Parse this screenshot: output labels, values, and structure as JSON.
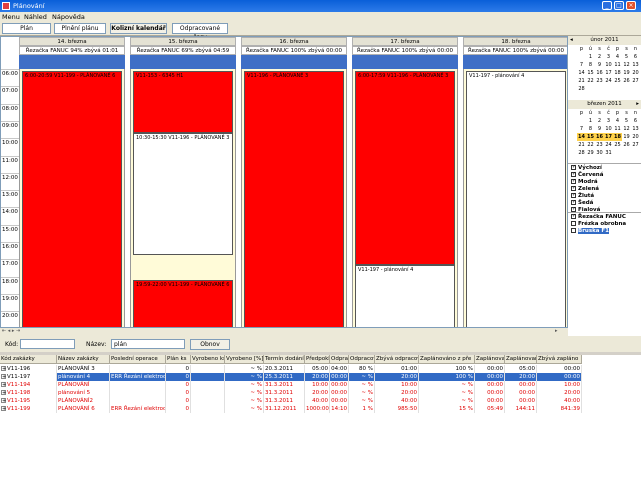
{
  "window": {
    "title": "Plánování"
  },
  "menu": [
    "Menu",
    "Náhled",
    "Nápověda"
  ],
  "toolbar": {
    "buttons": [
      "Plán",
      "Plnění plánu",
      "Kolizní kalendář",
      "Odpracované časy"
    ]
  },
  "times": [
    "06:00",
    "07:00",
    "08:00",
    "09:00",
    "10:00",
    "11:00",
    "12:00",
    "13:00",
    "14:00",
    "15:00",
    "16:00",
    "17:00",
    "18:00",
    "19:00",
    "20:00",
    "21:00"
  ],
  "days": [
    {
      "date": "14. března",
      "sub": "Řezačka FANUC 94% zbývá 01:01",
      "events": [
        {
          "label": "6:00-20:59 V11-199 - PLÁNOVANÉ 6",
          "color": "red"
        }
      ]
    },
    {
      "date": "15. března",
      "sub": "Řezačka FANUC 69% zbývá 04:59",
      "events": [
        {
          "label": "V11-153 - 6345 H1",
          "color": "red"
        },
        {
          "label": "10:30-15:30 V11-196 - PLÁNOVANÉ 3",
          "color": "white"
        },
        {
          "label": "19:59-22:00 V11-199 - PLÁNOVANÉ 6",
          "color": "red"
        }
      ]
    },
    {
      "date": "16. března",
      "sub": "Řezačka FANUC 100% zbývá 00:00",
      "events": [
        {
          "label": "V11-196 - PLÁNOVANÉ 3",
          "color": "red"
        }
      ]
    },
    {
      "date": "17. března",
      "sub": "Řezačka FANUC 100% zbývá 00:00",
      "events": [
        {
          "label": "6:00-17:59 V11-196 - PLÁNOVANÉ 3",
          "color": "red"
        },
        {
          "label": "V11-197 - plánování 4",
          "color": "white"
        }
      ]
    },
    {
      "date": "18. března",
      "sub": "Řezačka FANUC 100% zbývá 00:00",
      "events": [
        {
          "label": "V11-197 - plánování 4",
          "color": "white"
        }
      ]
    }
  ],
  "calendar": {
    "dow": [
      "p",
      "ú",
      "s",
      "č",
      "p",
      "s",
      "n"
    ],
    "feb": {
      "title": "únor 2011",
      "rows": [
        {
          "wk": "",
          "d": [
            "",
            "1",
            "2",
            "3",
            "4",
            "5",
            "6"
          ]
        },
        {
          "wk": "",
          "d": [
            "7",
            "8",
            "9",
            "10",
            "11",
            "12",
            "13"
          ]
        },
        {
          "wk": "",
          "d": [
            "14",
            "15",
            "16",
            "17",
            "18",
            "19",
            "20"
          ]
        },
        {
          "wk": "",
          "d": [
            "21",
            "22",
            "23",
            "24",
            "25",
            "26",
            "27"
          ]
        },
        {
          "wk": "",
          "d": [
            "28",
            "",
            "",
            "",
            "",
            "",
            ""
          ]
        }
      ]
    },
    "mar": {
      "title": "březen 2011",
      "rows": [
        {
          "wk": "",
          "d": [
            "",
            "1",
            "2",
            "3",
            "4",
            "5",
            "6"
          ]
        },
        {
          "wk": "",
          "d": [
            "7",
            "8",
            "9",
            "10",
            "11",
            "12",
            "13"
          ]
        },
        {
          "wk": "",
          "d": [
            "14",
            "15",
            "16",
            "17",
            "18",
            "19",
            "20"
          ]
        },
        {
          "wk": "",
          "d": [
            "21",
            "22",
            "23",
            "24",
            "25",
            "26",
            "27"
          ]
        },
        {
          "wk": "",
          "d": [
            "28",
            "29",
            "30",
            "31",
            "",
            "",
            ""
          ]
        }
      ]
    }
  },
  "colorFilters": [
    "Výchozí",
    "Červená",
    "Modrá",
    "Zelená",
    "Žlutá",
    "Šedá",
    "Fialová"
  ],
  "machineFilters": [
    "Řezačka FANUC",
    "Frézka obrobna",
    "Bruska F1"
  ],
  "filter": {
    "kod_label": "Kód:",
    "kod_value": "",
    "nazev_label": "Název:",
    "nazev_value": "plán",
    "button": "Obnov"
  },
  "grid": {
    "columns": [
      "Kód zakázky",
      "Název zakázky",
      "Poslední operace",
      "Plán ks",
      "Vyrobeno ks",
      "Vyrobeno [%]",
      "Termín dodání",
      "Předpoklá",
      "Odpracov",
      "Odpracov",
      "Zbývá odpracovat",
      "Zaplánováno z pře",
      "Zaplánovan",
      "Zaplánovan",
      "Zbývá zapláno"
    ],
    "rows": [
      {
        "c": [
          "V11-196",
          "PLÁNOVÁNÍ 3",
          "",
          "0",
          "",
          "~ %",
          "20.3.2011",
          "05:00",
          "04:00",
          "80 %",
          "01:00",
          "100 %",
          "00:00",
          "05:00",
          "00:00"
        ],
        "style": ""
      },
      {
        "c": [
          "V11-197",
          "plánování 4",
          "ERR Řezání elektrod",
          "0",
          "",
          "~ %",
          "25.3.2011",
          "20:00",
          "00:00",
          "~ %",
          "20:00",
          "100 %",
          "00:00",
          "20:00",
          "00:00"
        ],
        "style": "sel"
      },
      {
        "c": [
          "V11-194",
          "PLÁNOVÁNÍ",
          "",
          "0",
          "",
          "~ %",
          "31.3.2011",
          "10:00",
          "00:00",
          "~ %",
          "10:00",
          "~ %",
          "00:00",
          "00:00",
          "10:00"
        ],
        "style": "red"
      },
      {
        "c": [
          "V11-198",
          "plánování 5",
          "",
          "0",
          "",
          "~ %",
          "31.3.2011",
          "20:00",
          "00:00",
          "~ %",
          "20:00",
          "~ %",
          "00:00",
          "00:00",
          "20:00"
        ],
        "style": "red"
      },
      {
        "c": [
          "V11-195",
          "PLÁNOVÁNÍ2",
          "",
          "0",
          "",
          "~ %",
          "31.3.2011",
          "40:00",
          "00:00",
          "~ %",
          "40:00",
          "~ %",
          "00:00",
          "00:00",
          "40:00"
        ],
        "style": "red"
      },
      {
        "c": [
          "V11-199",
          "PLÁNOVÁNÍ 6",
          "ERR Řezání elektrod",
          "0",
          "",
          "~ %",
          "31.12.2011",
          "1000:00",
          "14:10",
          "1 %",
          "985:50",
          "15 %",
          "05:49",
          "144:11",
          "841:39"
        ],
        "style": "red"
      }
    ]
  }
}
